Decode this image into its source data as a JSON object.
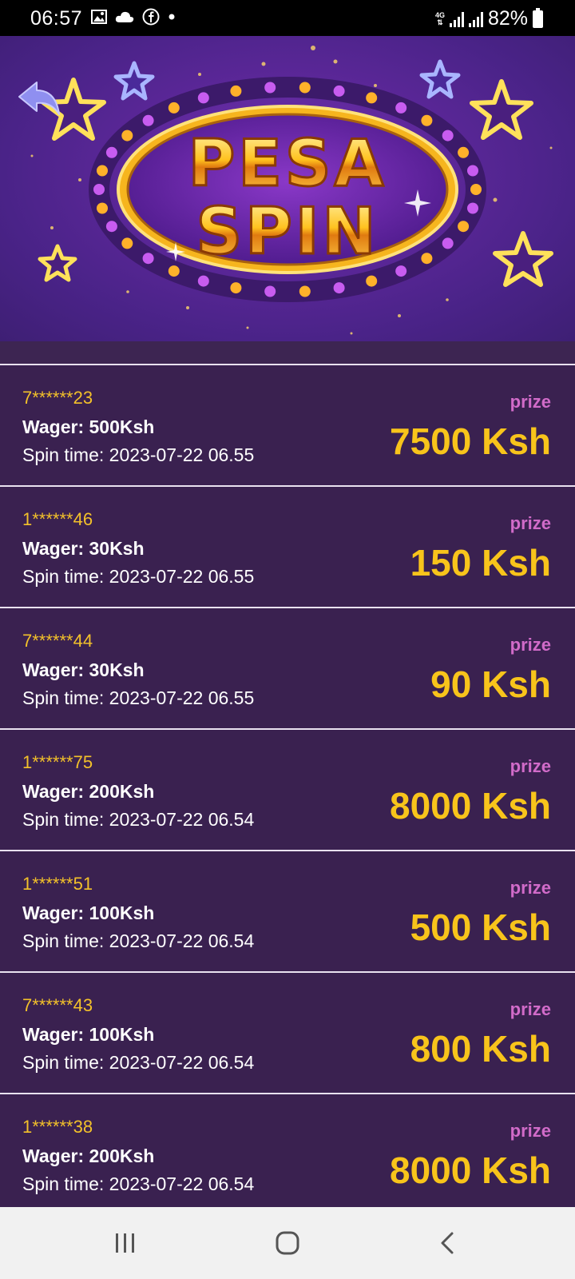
{
  "status_bar": {
    "time": "06:57",
    "network": "4G",
    "battery": "82%"
  },
  "banner": {
    "logo_line1": "PESA",
    "logo_line2": "SPIN"
  },
  "spins": [
    {
      "user": "7******23",
      "wager": "Wager: 500Ksh",
      "time": "Spin time: 2023-07-22 06.55",
      "prize_label": "prize",
      "amount": "7500 Ksh"
    },
    {
      "user": "1******46",
      "wager": "Wager: 30Ksh",
      "time": "Spin time: 2023-07-22 06.55",
      "prize_label": "prize",
      "amount": "150 Ksh"
    },
    {
      "user": "7******44",
      "wager": "Wager: 30Ksh",
      "time": "Spin time: 2023-07-22 06.55",
      "prize_label": "prize",
      "amount": "90 Ksh"
    },
    {
      "user": "1******75",
      "wager": "Wager: 200Ksh",
      "time": "Spin time: 2023-07-22 06.54",
      "prize_label": "prize",
      "amount": "8000 Ksh"
    },
    {
      "user": "1******51",
      "wager": "Wager: 100Ksh",
      "time": "Spin time: 2023-07-22 06.54",
      "prize_label": "prize",
      "amount": "500 Ksh"
    },
    {
      "user": "7******43",
      "wager": "Wager: 100Ksh",
      "time": "Spin time: 2023-07-22 06.54",
      "prize_label": "prize",
      "amount": "800 Ksh"
    },
    {
      "user": "1******38",
      "wager": "Wager: 200Ksh",
      "time": "Spin time: 2023-07-22 06.54",
      "prize_label": "prize",
      "amount": "8000 Ksh"
    }
  ],
  "icons": {
    "back": "back-arrow-icon",
    "recents": "recents-icon",
    "home": "home-icon",
    "nav_back": "nav-back-icon"
  },
  "colors": {
    "list_bg": "#3a2150",
    "username": "#f3c12a",
    "prize_label": "#d16bc9",
    "amount": "#f8c41b"
  }
}
